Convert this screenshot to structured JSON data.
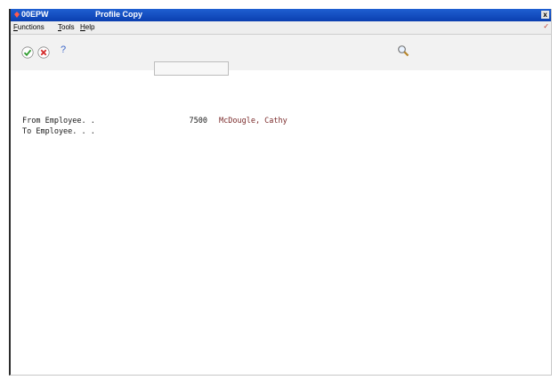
{
  "window": {
    "app_code": "00EPW",
    "title": "Profile Copy",
    "close_glyph": "x"
  },
  "menu": {
    "items": [
      {
        "underline": "F",
        "rest": "unctions"
      },
      {
        "underline": "T",
        "rest": "ools"
      },
      {
        "underline": "H",
        "rest": "elp"
      }
    ]
  },
  "toolbar": {
    "ok_icon": "check-icon",
    "cancel_icon": "cancel-icon",
    "help_icon": "question-icon",
    "search_icon": "magnifier-icon",
    "help_glyph": "?"
  },
  "form": {
    "from_label": "From Employee. .",
    "from_number": "7500",
    "from_name": "McDougle, Cathy",
    "to_label": "To Employee. . .",
    "to_value": ""
  },
  "colors": {
    "titlebar": "#1f5fd1",
    "name_text": "#7a2a2a"
  }
}
